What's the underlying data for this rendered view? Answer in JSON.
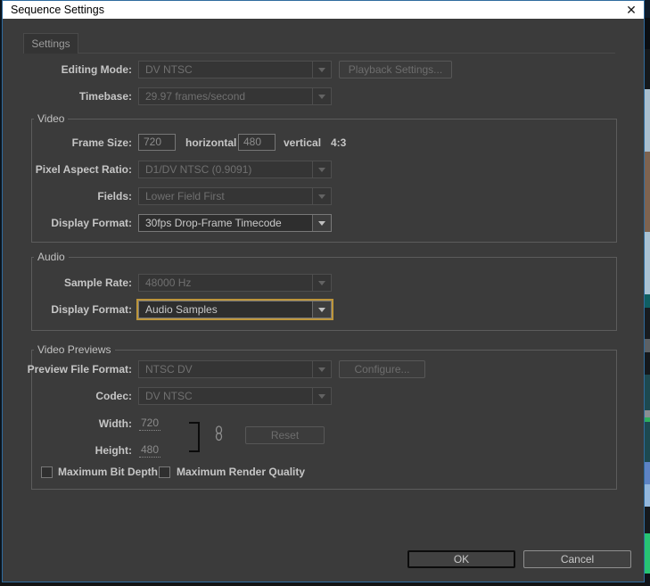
{
  "window": {
    "title": "Sequence Settings",
    "close_icon": "✕"
  },
  "tabs": {
    "settings": "Settings"
  },
  "general": {
    "editing_mode": {
      "label": "Editing Mode:",
      "value": "DV NTSC"
    },
    "playback_settings_button": "Playback Settings...",
    "timebase": {
      "label": "Timebase:",
      "value": "29.97 frames/second"
    }
  },
  "video": {
    "group_label": "Video",
    "frame_size": {
      "label": "Frame Size:",
      "horizontal_value": "720",
      "horizontal_label": "horizontal",
      "vertical_value": "480",
      "vertical_label": "vertical",
      "aspect_ratio": "4:3"
    },
    "pixel_aspect_ratio": {
      "label": "Pixel Aspect Ratio:",
      "value": "D1/DV NTSC (0.9091)"
    },
    "fields": {
      "label": "Fields:",
      "value": "Lower Field First"
    },
    "display_format": {
      "label": "Display Format:",
      "value": "30fps Drop-Frame Timecode"
    }
  },
  "audio": {
    "group_label": "Audio",
    "sample_rate": {
      "label": "Sample Rate:",
      "value": "48000 Hz"
    },
    "display_format": {
      "label": "Display Format:",
      "value": "Audio Samples"
    }
  },
  "video_previews": {
    "group_label": "Video Previews",
    "preview_file_format": {
      "label": "Preview File Format:",
      "value": "NTSC DV"
    },
    "configure_button": "Configure...",
    "codec": {
      "label": "Codec:",
      "value": "DV NTSC"
    },
    "width": {
      "label": "Width:",
      "value": "720"
    },
    "height": {
      "label": "Height:",
      "value": "480"
    },
    "reset_button": "Reset",
    "maximum_bit_depth_label": "Maximum Bit Depth",
    "maximum_render_quality_label": "Maximum Render Quality"
  },
  "footer": {
    "ok_label": "OK",
    "cancel_label": "Cancel"
  },
  "colors": {
    "dialog_background": "#3b3b3b",
    "dialog_border": "#2f6b9e",
    "titlebar_background": "#ffffff",
    "focus_accent": "#bd953b",
    "label_text": "#c6c6c6",
    "disabled_text": "#707070"
  }
}
